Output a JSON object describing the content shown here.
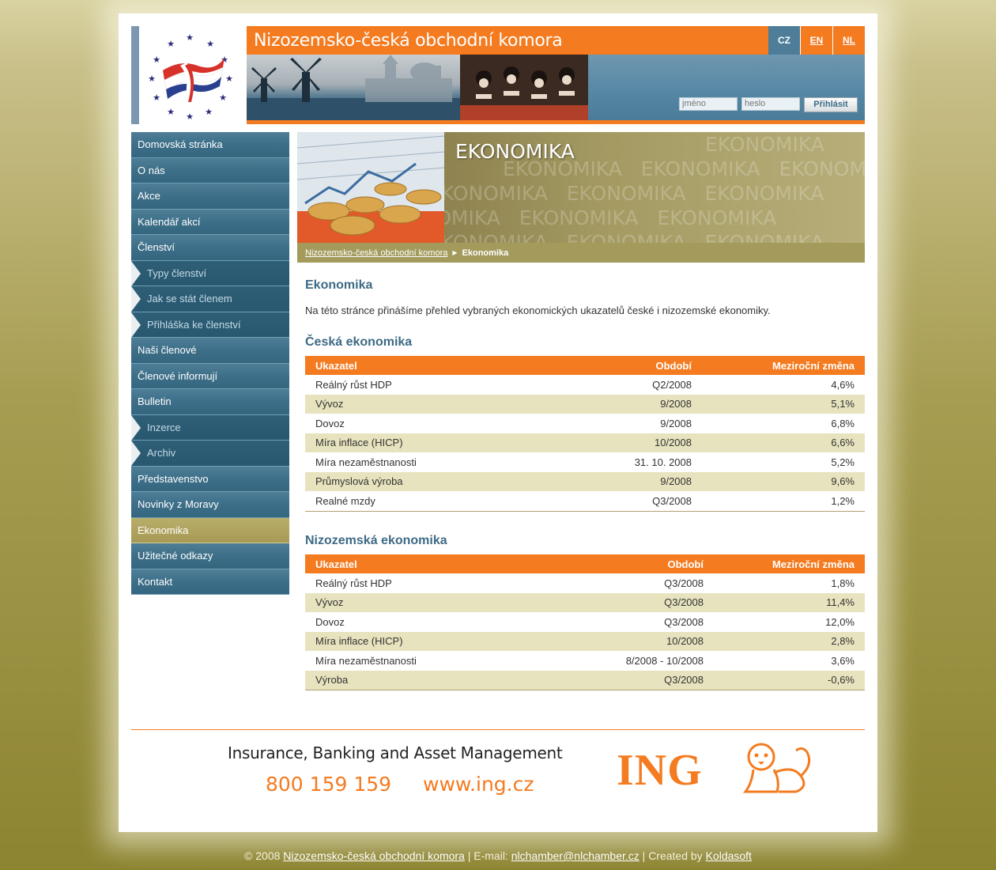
{
  "header": {
    "title": "Nizozemsko-česká obchodní komora",
    "languages": [
      "CZ",
      "EN",
      "NL"
    ],
    "login": {
      "name_placeholder": "jméno",
      "password_placeholder": "heslo",
      "submit_label": "Přihlásit"
    }
  },
  "sidebar": {
    "items": [
      {
        "label": "Domovská stránka"
      },
      {
        "label": "O nás"
      },
      {
        "label": "Akce"
      },
      {
        "label": "Kalendář akcí"
      },
      {
        "label": "Členství"
      },
      {
        "label": "Typy členství"
      },
      {
        "label": "Jak se stát členem"
      },
      {
        "label": "Přihláška ke členství"
      },
      {
        "label": "Naši členové"
      },
      {
        "label": "Členové informují"
      },
      {
        "label": "Bulletin"
      },
      {
        "label": "Inzerce"
      },
      {
        "label": "Archiv"
      },
      {
        "label": "Představenstvo"
      },
      {
        "label": "Novinky z Moravy"
      },
      {
        "label": "Ekonomika"
      },
      {
        "label": "Užitečné odkazy"
      },
      {
        "label": "Kontakt"
      }
    ]
  },
  "banner": {
    "title": "EKONOMIKA",
    "word": "EKONOMIKA",
    "breadcrumb_home": "Nizozemsko-česká obchodní komora",
    "breadcrumb_current": "Ekonomika"
  },
  "content": {
    "title": "Ekonomika",
    "intro": "Na této stránce přinášíme přehled vybraných ekonomických ukazatelů české i nizozemské ekonomiky.",
    "cz_heading": "Česká ekonomika",
    "nl_heading": "Nizozemská ekonomika",
    "columns": [
      "Ukazatel",
      "Období",
      "Meziroční změna"
    ],
    "cz_rows": [
      [
        "Reálný růst HDP",
        "Q2/2008",
        "4,6%"
      ],
      [
        "Vývoz",
        "9/2008",
        "5,1%"
      ],
      [
        "Dovoz",
        "9/2008",
        "6,8%"
      ],
      [
        "Míra inflace (HICP)",
        "10/2008",
        "6,6%"
      ],
      [
        "Míra nezaměstnanosti",
        "31. 10. 2008",
        "5,2%"
      ],
      [
        "Průmyslová výroba",
        "9/2008",
        "9,6%"
      ],
      [
        "Realné mzdy",
        "Q3/2008",
        "1,2%"
      ]
    ],
    "nl_rows": [
      [
        "Reálný růst HDP",
        "Q3/2008",
        "1,8%"
      ],
      [
        "Vývoz",
        "Q3/2008",
        "11,4%"
      ],
      [
        "Dovoz",
        "Q3/2008",
        "12,0%"
      ],
      [
        "Míra inflace (HICP)",
        "10/2008",
        "2,8%"
      ],
      [
        "Míra nezaměstnanosti",
        "8/2008 - 10/2008",
        "3,6%"
      ],
      [
        "Výroba",
        "Q3/2008",
        "-0,6%"
      ]
    ]
  },
  "ad": {
    "tagline": "Insurance, Banking and Asset Management",
    "phone": "800 159 159",
    "url": "www.ing.cz",
    "brand": "ING"
  },
  "footer": {
    "copyright": "© 2008",
    "org_link": "Nizozemsko-česká obchodní komora",
    "email_label": "| E-mail:",
    "email": "nlchamber@nlchamber.cz",
    "created_label": "| Created by",
    "creator": "Koldasoft"
  },
  "colors": {
    "orange": "#f47b20",
    "nav_blue": "#3d6f88",
    "olive": "#a39a5c",
    "row_alt": "#e7e3be"
  }
}
